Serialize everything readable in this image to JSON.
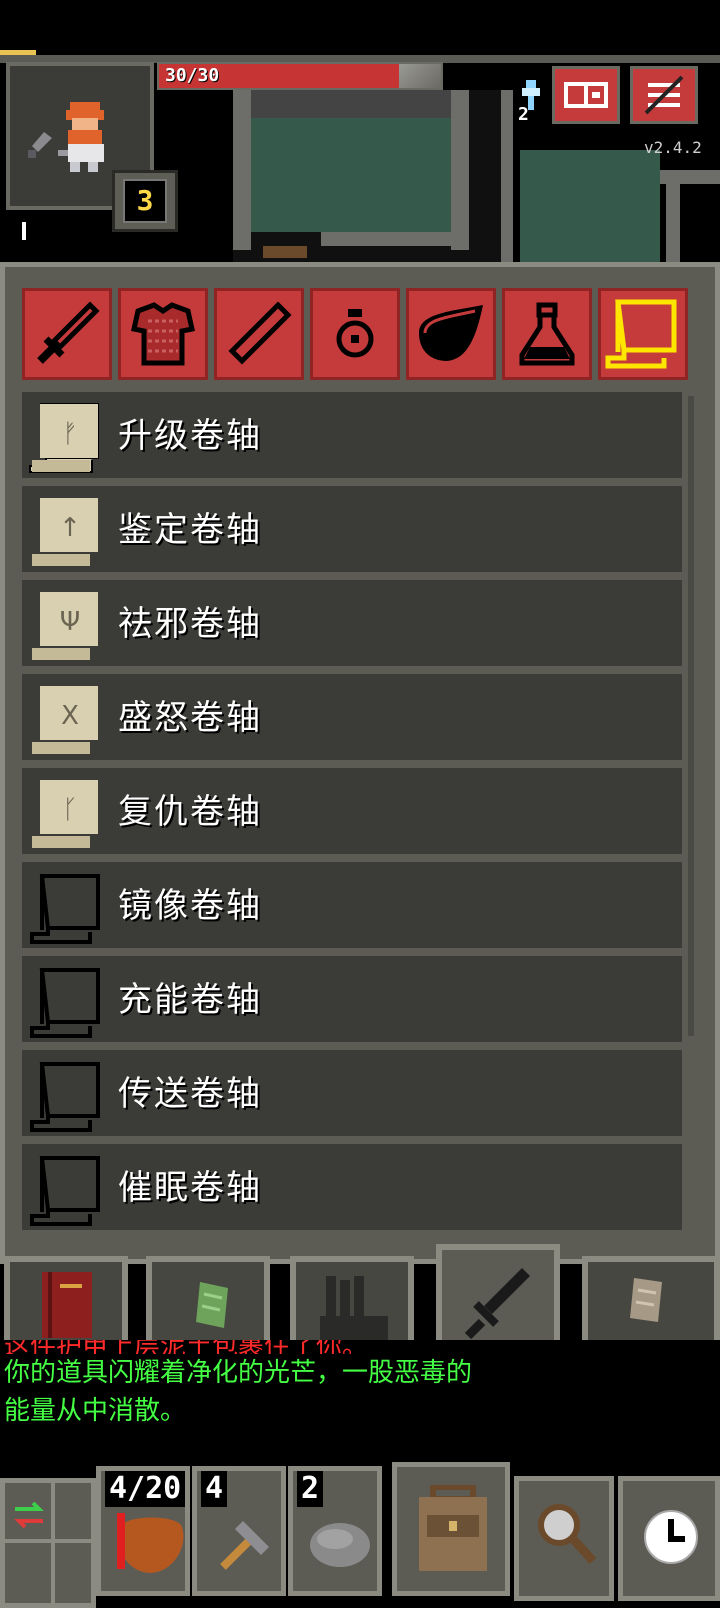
{
  "hud": {
    "hp_text": "30/30",
    "hp_fraction": 1.0,
    "level": "3",
    "keys": "2",
    "version": "v2.4.2",
    "journal_icon": "journal-icon",
    "menu_icon": "menu-icon"
  },
  "categories": [
    {
      "name": "weapon",
      "icon": "sword-icon"
    },
    {
      "name": "armor",
      "icon": "chainmail-icon"
    },
    {
      "name": "wand",
      "icon": "wand-icon"
    },
    {
      "name": "ring",
      "icon": "ring-icon"
    },
    {
      "name": "artifact",
      "icon": "horn-icon"
    },
    {
      "name": "potion",
      "icon": "potion-icon"
    },
    {
      "name": "scroll",
      "icon": "scroll-icon",
      "active": true
    }
  ],
  "items": [
    {
      "label": "升级卷轴",
      "rune": "ᚠ",
      "known": true
    },
    {
      "label": "鉴定卷轴",
      "rune": "↑",
      "known": true
    },
    {
      "label": "祛邪卷轴",
      "rune": "Ψ",
      "known": true
    },
    {
      "label": "盛怒卷轴",
      "rune": "X",
      "known": true
    },
    {
      "label": "复仇卷轴",
      "rune": "ᚴ",
      "known": true
    },
    {
      "label": "镜像卷轴",
      "rune": "",
      "known": false
    },
    {
      "label": "充能卷轴",
      "rune": "",
      "known": false
    },
    {
      "label": "传送卷轴",
      "rune": "",
      "known": false
    },
    {
      "label": "催眠卷轴",
      "rune": "",
      "known": false
    }
  ],
  "log": {
    "line1": "这件护甲上层泥土包裹住了你。",
    "line2": "你的道具闪耀着净化的光芒，一股恶毒的",
    "line3": "能量从中消散。"
  },
  "toolbar": {
    "quickslot1": "4/20",
    "quickslot2": "4",
    "quickslot3": "2",
    "backpack_icon": "backpack-icon",
    "search_icon": "search-icon",
    "wait_icon": "clock-icon"
  },
  "colors": {
    "accent_red": "#c53b3b",
    "active_tab_outline": "#ffe600",
    "log_green": "#44ff44",
    "hp_red": "#c73434"
  }
}
